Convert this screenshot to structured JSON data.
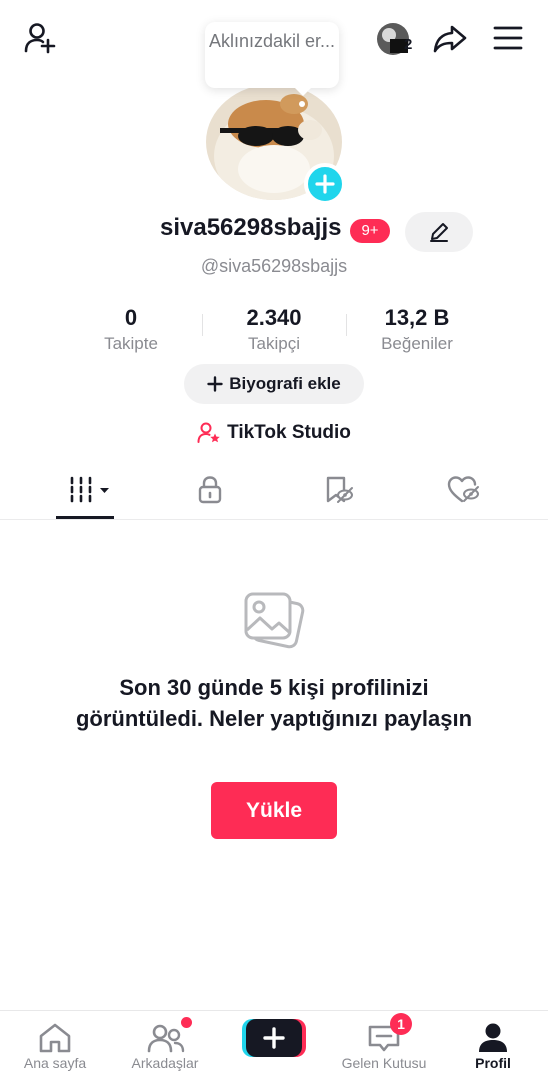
{
  "header": {
    "tooltip_text": "Aklınızdakil er...",
    "account_count": "2"
  },
  "profile": {
    "username": "siva56298sbajjs",
    "notification_badge": "9+",
    "handle": "@siva56298sbajjs"
  },
  "stats": [
    {
      "value": "0",
      "label": "Takipte"
    },
    {
      "value": "2.340",
      "label": "Takipçi"
    },
    {
      "value": "13,2 B",
      "label": "Beğeniler"
    }
  ],
  "bio_button_label": "Biyografi ekle",
  "studio_label": "TikTok Studio",
  "empty_state": {
    "message": "Son 30 günde 5 kişi profilinizi görüntüledi. Neler yaptığınızı paylaşın",
    "button_label": "Yükle"
  },
  "bottom_nav": {
    "home": "Ana sayfa",
    "friends": "Arkadaşlar",
    "inbox": "Gelen Kutusu",
    "inbox_badge": "1",
    "profile": "Profil"
  },
  "colors": {
    "accent": "#fe2c55",
    "cyan": "#20d5ec",
    "text": "#161823",
    "secondary": "#8a8b91"
  }
}
